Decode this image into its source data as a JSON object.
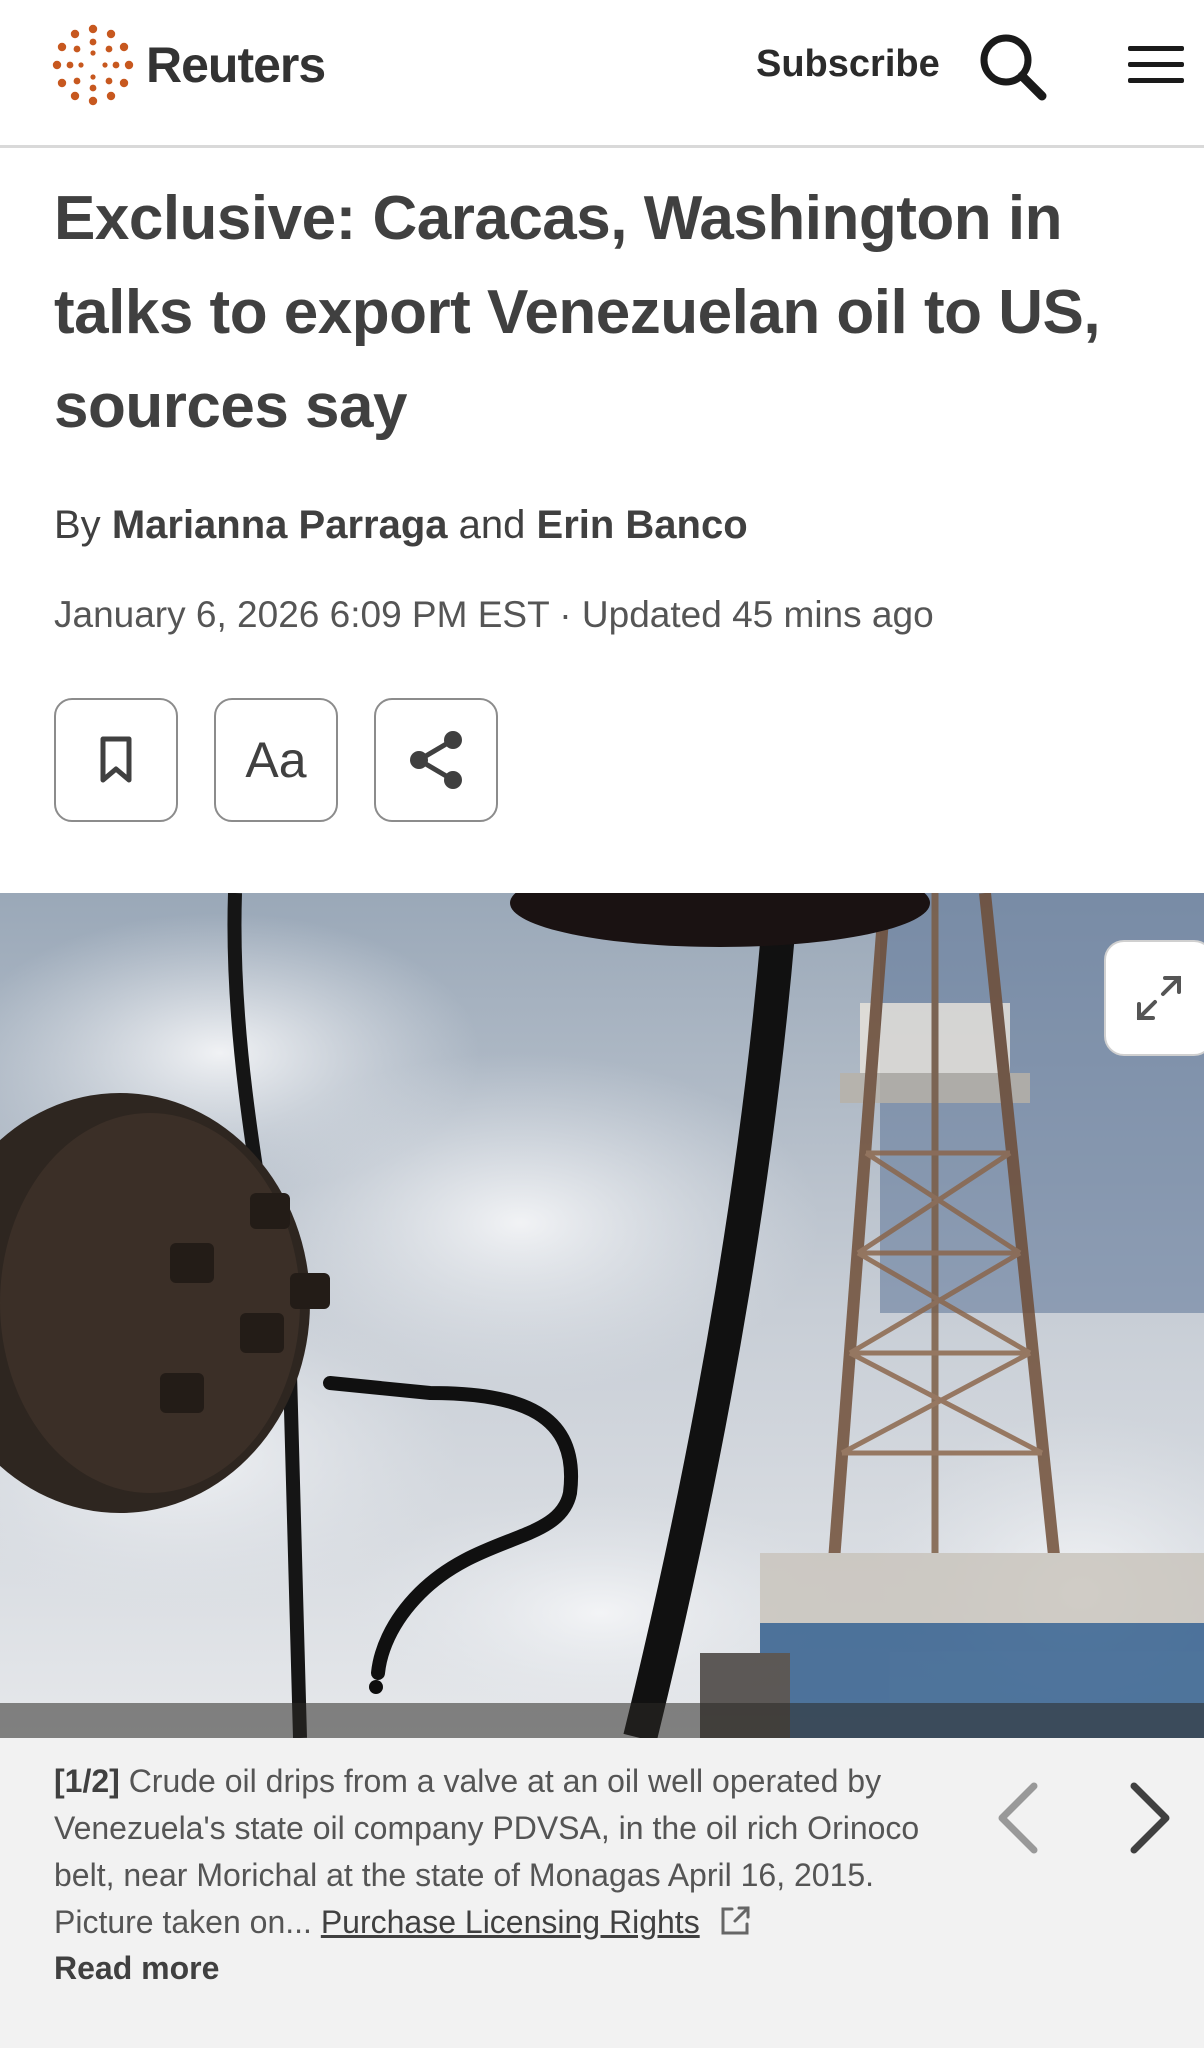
{
  "header": {
    "brand": "Reuters",
    "brand_color": "#c7581f",
    "subscribe_label": "Subscribe",
    "search_icon": "search-icon",
    "menu_icon": "hamburger-menu-icon"
  },
  "article": {
    "headline": "Exclusive: Caracas, Washington in talks to export Venezuelan oil to US, sources say",
    "byline": {
      "prefix": "By",
      "author1": "Marianna Parraga",
      "joiner": "and",
      "author2": "Erin Banco"
    },
    "date": "January 6, 2026 6:09 PM EST",
    "separator": "·",
    "updated": "Updated 45 mins ago",
    "tools": {
      "bookmark_icon": "bookmark-icon",
      "text_size_label": "Aa",
      "share_icon": "share-icon"
    }
  },
  "gallery": {
    "expand_icon": "expand-icon",
    "caption_index": "[1/2]",
    "caption_text": "Crude oil drips from a valve at an oil well operated by Venezuela's state oil company PDVSA, in the oil rich Orinoco belt, near Morichal at the state of Monagas April 16, 2015. Picture taken on...",
    "licensing_label": "Purchase Licensing Rights",
    "external_link_icon": "external-link-icon",
    "read_more_label": "Read more",
    "prev_icon": "chevron-left-icon",
    "next_icon": "chevron-right-icon"
  }
}
